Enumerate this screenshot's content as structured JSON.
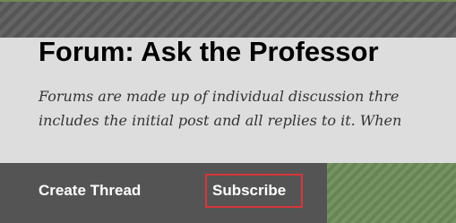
{
  "page": {
    "title": "Forum: Ask the Professor",
    "description_lines": [
      "Forums are made up of individual discussion thre",
      "includes the initial post and all replies to it. When"
    ]
  },
  "actions": {
    "create_thread_label": "Create Thread",
    "subscribe_label": "Subscribe"
  },
  "colors": {
    "action_bar": "#545454",
    "green_band": "#6b8a57",
    "highlight_border": "#d9353b",
    "header_background": "#dddddd"
  }
}
